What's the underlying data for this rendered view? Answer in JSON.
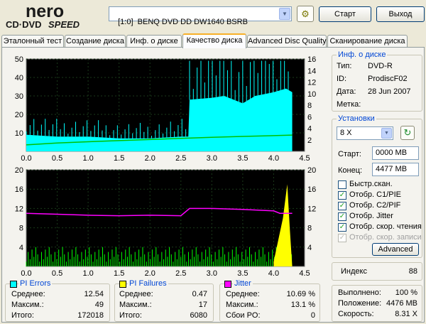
{
  "app": {
    "logo_top": "nero",
    "logo_bottom": "CD·DVD",
    "logo_speed": "SPEED",
    "drive": "[1:0]  BENQ DVD DD DW1640 BSRB",
    "start_label": "Старт",
    "exit_label": "Выход"
  },
  "tabs": [
    {
      "label": "Эталонный тест"
    },
    {
      "label": "Создание диска"
    },
    {
      "label": "Инф. о диске"
    },
    {
      "label": "Качество диска",
      "active": true
    },
    {
      "label": "Advanced Disc Quality"
    },
    {
      "label": "Сканирование диска"
    }
  ],
  "disc_info": {
    "title": "Инф. о диске",
    "type_label": "Тип:",
    "type_value": "DVD-R",
    "id_label": "ID:",
    "id_value": "ProdiscF02",
    "date_label": "Дата:",
    "date_value": "28 Jun 2007",
    "mark_label": "Метка:",
    "mark_value": ""
  },
  "settings": {
    "title": "Установки",
    "speed": "8 X",
    "start_label": "Старт:",
    "start_value": "0000 MB",
    "end_label": "Конец:",
    "end_value": "4477 MB",
    "checkboxes": [
      {
        "label": "Быстр.скан.",
        "checked": false,
        "enabled": true
      },
      {
        "label": "Отобр. C1/PIE",
        "checked": true,
        "enabled": true
      },
      {
        "label": "Отобр. C2/PIF",
        "checked": true,
        "enabled": true
      },
      {
        "label": "Отобр. Jitter",
        "checked": true,
        "enabled": true
      },
      {
        "label": "Отобр. скор. чтения",
        "checked": true,
        "enabled": true
      },
      {
        "label": "Отобр. скор. записи",
        "checked": true,
        "enabled": false
      }
    ],
    "advanced_label": "Advanced"
  },
  "index": {
    "label": "Индекс",
    "value": "88"
  },
  "progress": {
    "done_label": "Выполнено:",
    "done_value": "100 %",
    "pos_label": "Положение:",
    "pos_value": "4476 MB",
    "speed_label": "Скорость:",
    "speed_value": "8.31 X"
  },
  "stats": {
    "pi_errors": {
      "title": "PI Errors",
      "color": "#00ffff",
      "avg_label": "Среднее:",
      "avg": "12.54",
      "max_label": "Максим.:",
      "max": "49",
      "total_label": "Итого:",
      "total": "172018"
    },
    "pi_failures": {
      "title": "PI Failures",
      "color": "#ffff00",
      "avg_label": "Среднее:",
      "avg": "0.47",
      "max_label": "Максим.:",
      "max": "17",
      "total_label": "Итого:",
      "total": "6080"
    },
    "jitter": {
      "title": "Jitter",
      "color": "#ff00ff",
      "avg_label": "Среднее:",
      "avg": "10.69 %",
      "max_label": "Максим.:",
      "max": "13.1 %",
      "po_label": "Сбои PO:",
      "po": "0"
    }
  },
  "chart_data": [
    {
      "type": "area",
      "x_ticks": [
        "0.0",
        "0.5",
        "1.0",
        "1.5",
        "2.0",
        "2.5",
        "3.0",
        "3.5",
        "4.0",
        "4.5"
      ],
      "y_left_ticks": [
        "10",
        "20",
        "30",
        "40",
        "50"
      ],
      "y_right_ticks": [
        "2",
        "4",
        "6",
        "8",
        "10",
        "12",
        "14",
        "16"
      ],
      "xlim": [
        0,
        4.5
      ],
      "ylim_left": [
        0,
        50
      ],
      "ylim_right": [
        0,
        16
      ],
      "series": [
        {
          "color": "#00ffff",
          "points": [
            [
              0,
              9
            ],
            [
              0.5,
              8
            ],
            [
              1.0,
              8
            ],
            [
              1.5,
              7
            ],
            [
              2.0,
              7
            ],
            [
              2.5,
              8
            ],
            [
              2.62,
              8
            ],
            [
              2.64,
              28
            ],
            [
              3.0,
              29
            ],
            [
              3.2,
              30
            ],
            [
              3.5,
              26
            ],
            [
              3.7,
              30
            ],
            [
              4.0,
              32
            ],
            [
              4.2,
              34
            ],
            [
              4.3,
              32
            ]
          ]
        },
        {
          "color": "#00c000",
          "points": [
            [
              0,
              3.5
            ],
            [
              0.5,
              4.5
            ],
            [
              1.0,
              5.2
            ],
            [
              1.5,
              5.8
            ],
            [
              2.0,
              6.4
            ],
            [
              2.5,
              7.0
            ],
            [
              3.0,
              7.6
            ],
            [
              3.5,
              8.1
            ],
            [
              4.0,
              8.5
            ],
            [
              4.3,
              8.8
            ]
          ]
        }
      ]
    },
    {
      "type": "bar",
      "x_ticks": [
        "0.0",
        "0.5",
        "1.0",
        "1.5",
        "2.0",
        "2.5",
        "3.0",
        "3.5",
        "4.0",
        "4.5"
      ],
      "y_left_ticks": [
        "4",
        "8",
        "12",
        "16",
        "20"
      ],
      "y_right_ticks": [
        "4",
        "8",
        "12",
        "16",
        "20"
      ],
      "xlim": [
        0,
        4.5
      ],
      "ylim_left": [
        0,
        20
      ],
      "series": [
        {
          "color": "#00ff00",
          "points": [
            [
              0,
              2
            ],
            [
              0.5,
              2
            ],
            [
              1.0,
              2
            ],
            [
              1.5,
              2
            ],
            [
              2.0,
              2
            ],
            [
              2.5,
              2
            ],
            [
              3.0,
              1
            ],
            [
              3.5,
              1
            ],
            [
              4.0,
              2
            ],
            [
              4.1,
              3
            ]
          ]
        },
        {
          "color": "#ffff00",
          "points": [
            [
              4.0,
              1
            ],
            [
              4.15,
              10
            ],
            [
              4.22,
              17
            ],
            [
              4.26,
              8
            ],
            [
              4.3,
              0
            ]
          ]
        },
        {
          "color": "#ff00ff",
          "points": [
            [
              0,
              11
            ],
            [
              0.5,
              10.8
            ],
            [
              1.0,
              10.6
            ],
            [
              1.5,
              10.5
            ],
            [
              2.0,
              10.6
            ],
            [
              2.5,
              10.5
            ],
            [
              2.64,
              12
            ],
            [
              3.0,
              12
            ],
            [
              3.5,
              11.8
            ],
            [
              4.0,
              11.5
            ],
            [
              4.1,
              11
            ],
            [
              4.3,
              11
            ]
          ]
        }
      ]
    }
  ]
}
